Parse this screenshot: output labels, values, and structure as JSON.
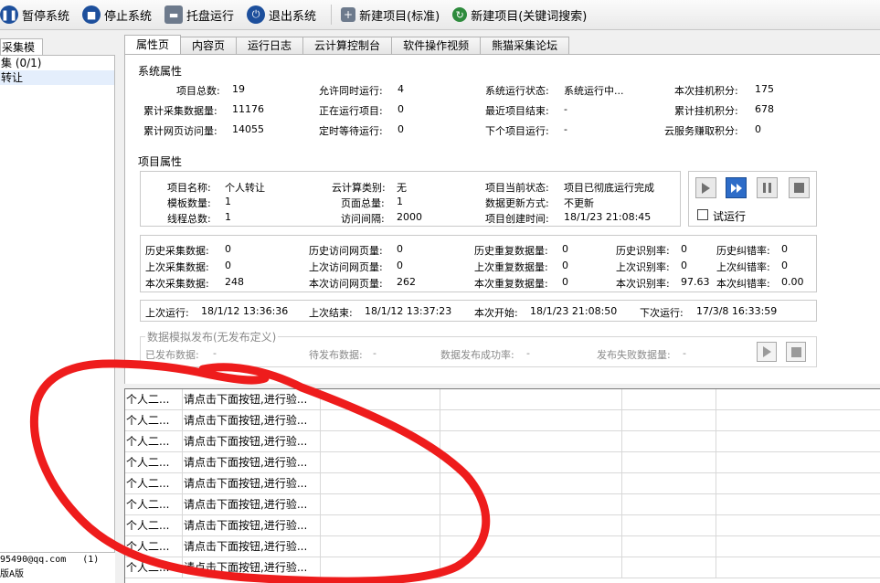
{
  "toolbar": {
    "pause": "暂停系统",
    "stop": "停止系统",
    "tray": "托盘运行",
    "exit": "退出系统",
    "new_standard": "新建项目(标准)",
    "new_keyword": "新建项目(关键词搜索)"
  },
  "left": {
    "tab": "采集模板",
    "rows": [
      "集 (0/1)",
      "转让"
    ],
    "footer_email": "95490@qq.com",
    "footer_count": "(1)",
    "footer_edition": "版A版"
  },
  "tabs": [
    "属性页",
    "内容页",
    "运行日志",
    "云计算控制台",
    "软件操作视频",
    "熊猫采集论坛"
  ],
  "system": {
    "title": "系统属性",
    "total_label": "项目总数:",
    "total": "19",
    "concurrent_label": "允许同时运行:",
    "concurrent": "4",
    "state_label": "系统运行状态:",
    "state": "系统运行中...",
    "hang_label": "本次挂机积分:",
    "hang": "175",
    "collected_label": "累计采集数据量:",
    "collected": "11176",
    "running_label": "正在运行项目:",
    "running": "0",
    "last_end_label": "最近项目结束:",
    "last_end": "-",
    "acc_hang_label": "累计挂机积分:",
    "acc_hang": "678",
    "visits_label": "累计网页访问量:",
    "visits": "14055",
    "timed_label": "定时等待运行:",
    "timed": "0",
    "next_label": "下个项目运行:",
    "next": "-",
    "cloud_label": "云服务赚取积分:",
    "cloud": "0"
  },
  "project": {
    "title": "项目属性",
    "name_label": "项目名称:",
    "name": "个人转让",
    "cloud_type_label": "云计算类别:",
    "cloud_type": "无",
    "cur_state_label": "项目当前状态:",
    "cur_state": "项目已彻底运行完成",
    "tpl_label": "模板数量:",
    "tpl": "1",
    "pages_label": "页面总量:",
    "pages": "1",
    "update_label": "数据更新方式:",
    "update": "不更新",
    "threads_label": "线程总数:",
    "threads": "1",
    "interval_label": "访问间隔:",
    "interval": "2000",
    "created_label": "项目创建时间:",
    "created": "18/1/23 21:08:45",
    "trial_label": "试运行"
  },
  "stats": {
    "hist_collect_l": "历史采集数据:",
    "hist_collect": "0",
    "hist_visit_l": "历史访问网页量:",
    "hist_visit": "0",
    "hist_dup_l": "历史重复数据量:",
    "hist_dup": "0",
    "hist_rec_l": "历史识别率:",
    "hist_rec": "0",
    "hist_err_l": "历史纠错率:",
    "hist_err": "0",
    "last_collect_l": "上次采集数据:",
    "last_collect": "0",
    "last_visit_l": "上次访问网页量:",
    "last_visit": "0",
    "last_dup_l": "上次重复数据量:",
    "last_dup": "0",
    "last_rec_l": "上次识别率:",
    "last_rec": "0",
    "last_err_l": "上次纠错率:",
    "last_err": "0",
    "cur_collect_l": "本次采集数据:",
    "cur_collect": "248",
    "cur_visit_l": "本次访问网页量:",
    "cur_visit": "262",
    "cur_dup_l": "本次重复数据量:",
    "cur_dup": "0",
    "cur_rec_l": "本次识别率:",
    "cur_rec": "97.63",
    "cur_err_l": "本次纠错率:",
    "cur_err": "0.00"
  },
  "times": {
    "last_run_l": "上次运行:",
    "last_run": "18/1/12 13:36:36",
    "last_end_l": "上次结束:",
    "last_end": "18/1/12 13:37:23",
    "this_start_l": "本次开始:",
    "this_start": "18/1/23 21:08:50",
    "next_run_l": "下次运行:",
    "next_run": "17/3/8 16:33:59"
  },
  "publish": {
    "title": "数据模拟发布(无发布定义)",
    "published_l": "已发布数据:",
    "published": "-",
    "pending_l": "待发布数据:",
    "pending": "-",
    "rate_l": "数据发布成功率:",
    "rate": "-",
    "fail_l": "发布失败数据量:",
    "fail": "-"
  },
  "grid": {
    "rows": [
      [
        "个人二...",
        "请点击下面按钮,进行验..."
      ],
      [
        "个人二...",
        "请点击下面按钮,进行验..."
      ],
      [
        "个人二...",
        "请点击下面按钮,进行验..."
      ],
      [
        "个人二...",
        "请点击下面按钮,进行验..."
      ],
      [
        "个人二...",
        "请点击下面按钮,进行验..."
      ],
      [
        "个人二...",
        "请点击下面按钮,进行验..."
      ],
      [
        "个人二...",
        "请点击下面按钮,进行验..."
      ],
      [
        "个人二...",
        "请点击下面按钮,进行验..."
      ],
      [
        "个人二...",
        "请点击下面按钮,进行验..."
      ]
    ]
  },
  "colors": {
    "accent": "#1d4f9c",
    "annotation": "#ee1c1c"
  }
}
